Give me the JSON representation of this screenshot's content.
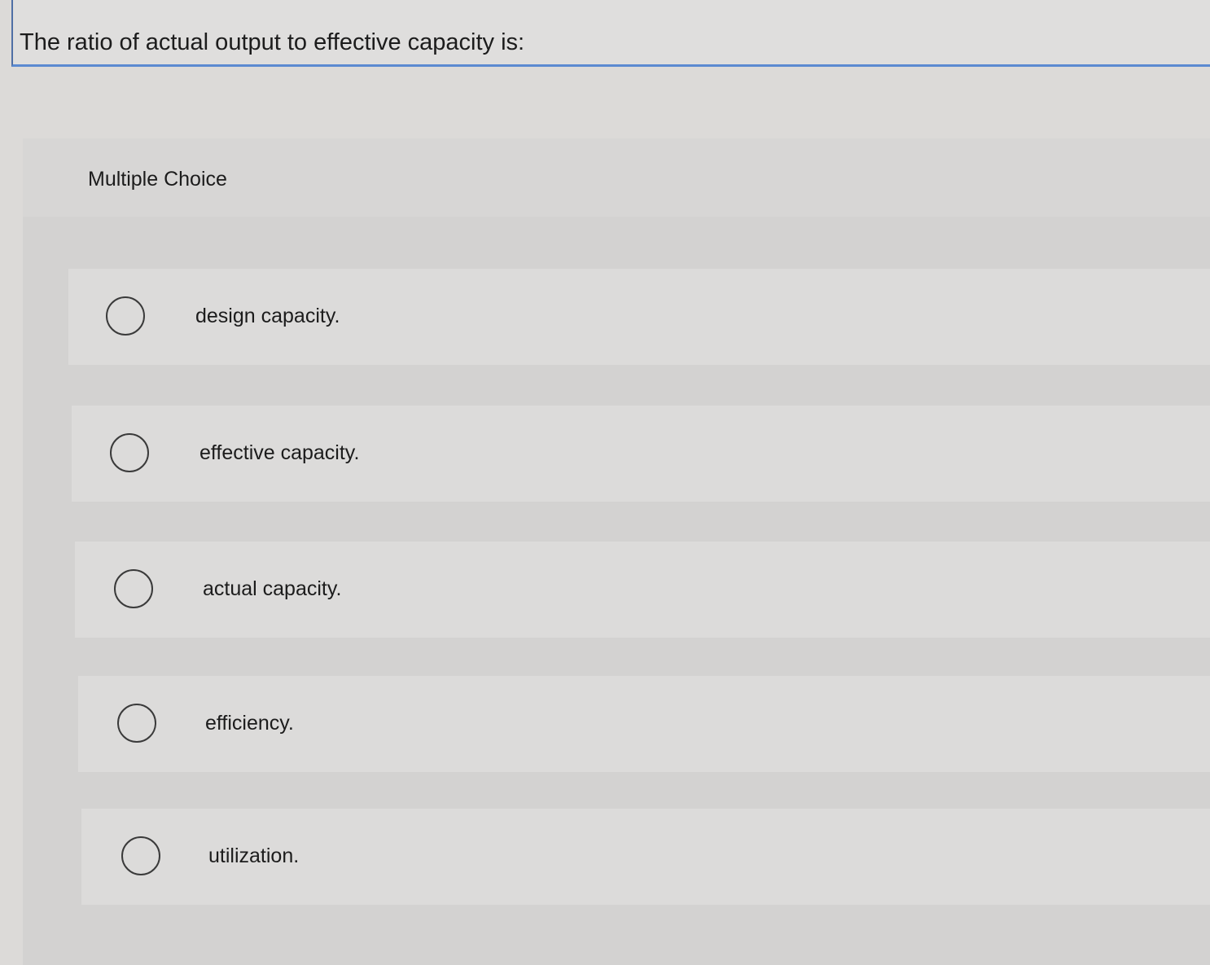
{
  "question": {
    "text": "The ratio of actual output to effective capacity is:"
  },
  "multiple_choice": {
    "label": "Multiple Choice",
    "options": [
      {
        "label": "design capacity.",
        "selected": false
      },
      {
        "label": "effective capacity.",
        "selected": false
      },
      {
        "label": "actual capacity.",
        "selected": false
      },
      {
        "label": "efficiency.",
        "selected": false
      },
      {
        "label": "utilization.",
        "selected": false
      }
    ]
  }
}
